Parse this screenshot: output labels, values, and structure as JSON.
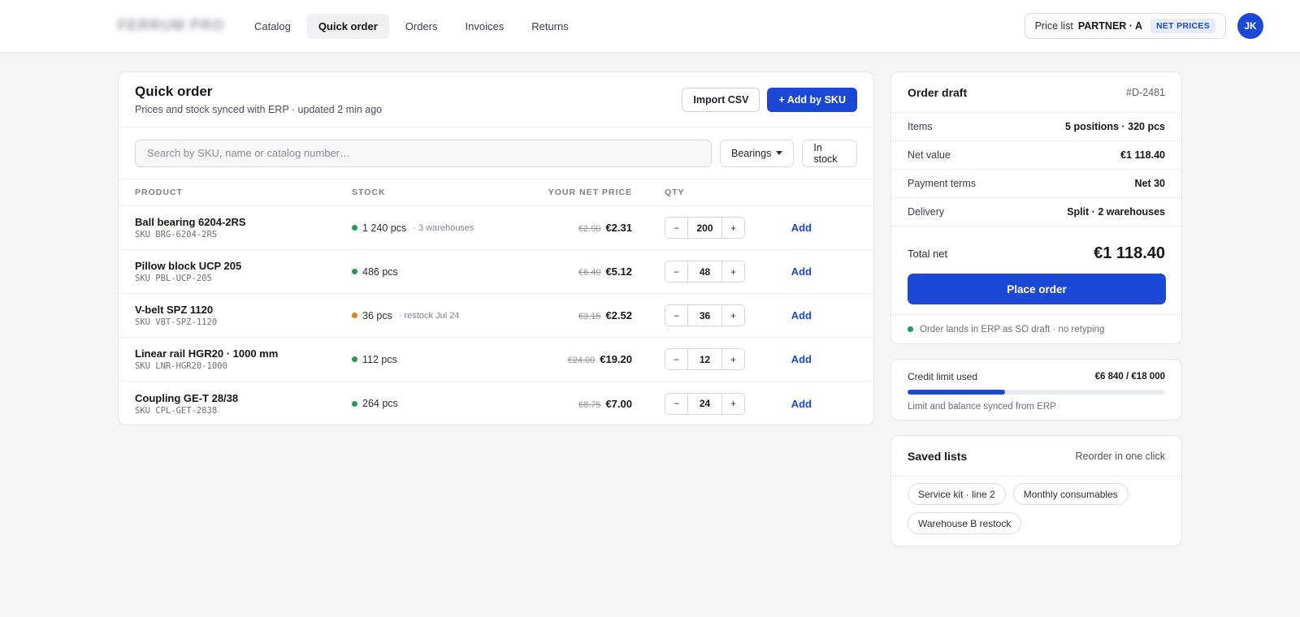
{
  "brand": {
    "name": "FERRUM PRO"
  },
  "nav": {
    "items": [
      {
        "label": "Catalog",
        "active": false
      },
      {
        "label": "Quick order",
        "active": true
      },
      {
        "label": "Orders",
        "active": false
      },
      {
        "label": "Invoices",
        "active": false
      },
      {
        "label": "Returns",
        "active": false
      }
    ]
  },
  "pricelist": {
    "label": "Price list",
    "value": "PARTNER · A",
    "badge": "NET PRICES"
  },
  "user": {
    "initials": "JK"
  },
  "quick_order": {
    "title": "Quick order",
    "subtitle": "Prices and stock synced with ERP · updated 2 min ago",
    "import_label": "Import CSV",
    "add_sku_label": "+ Add by SKU",
    "search_placeholder": "Search by SKU, name or catalog number…",
    "filter_category": "Bearings",
    "filter_stock": "In stock",
    "columns": {
      "product": "PRODUCT",
      "stock": "STOCK",
      "price": "YOUR NET PRICE",
      "qty": "QTY"
    },
    "add_label": "Add",
    "rows": [
      {
        "name": "Ball bearing 6204-2RS",
        "sku": "SKU BRG-6204-2RS",
        "stock": "1 240 pcs",
        "stock_note": "· 3 warehouses",
        "stock_status": "in",
        "old_price": "€2.90",
        "price": "€2.31",
        "qty": "200"
      },
      {
        "name": "Pillow block UCP 205",
        "sku": "SKU PBL-UCP-205",
        "stock": "486 pcs",
        "stock_note": "",
        "stock_status": "in",
        "old_price": "€6.40",
        "price": "€5.12",
        "qty": "48"
      },
      {
        "name": "V-belt SPZ 1120",
        "sku": "SKU VBT-SPZ-1120",
        "stock": "36 pcs",
        "stock_note": "· restock Jul 24",
        "stock_status": "low",
        "old_price": "€3.15",
        "price": "€2.52",
        "qty": "36"
      },
      {
        "name": "Linear rail HGR20 · 1000 mm",
        "sku": "SKU LNR-HGR20-1000",
        "stock": "112 pcs",
        "stock_note": "",
        "stock_status": "in",
        "old_price": "€24.00",
        "price": "€19.20",
        "qty": "12"
      },
      {
        "name": "Coupling GE-T 28/38",
        "sku": "SKU CPL-GET-2838",
        "stock": "264 pcs",
        "stock_note": "",
        "stock_status": "in",
        "old_price": "€8.75",
        "price": "€7.00",
        "qty": "24"
      }
    ]
  },
  "draft": {
    "title": "Order draft",
    "id": "#D-2481",
    "items_label": "Items",
    "items_value": "5 positions · 320 pcs",
    "net_label": "Net value",
    "net_value": "€1 118.40",
    "terms_label": "Payment terms",
    "terms_value": "Net 30",
    "delivery_label": "Delivery",
    "delivery_value": "Split · 2 warehouses",
    "total_label": "Total net",
    "total_value": "€1 118.40",
    "place_label": "Place order",
    "footer_note": "Order lands in ERP as SO draft · no retyping"
  },
  "credit": {
    "label": "Credit limit used",
    "value": "€6 840 / €18 000",
    "used_fraction": 0.38,
    "note": "Limit and balance synced from ERP"
  },
  "saved_lists": {
    "title": "Saved lists",
    "action": "Reorder in one click",
    "items": [
      "Service kit · line 2",
      "Monthly consumables",
      "Warehouse B restock"
    ]
  },
  "colors": {
    "accent": "#1b48d4",
    "in_stock": "#1f9d55",
    "low_stock": "#d9861c"
  },
  "icons": {
    "status": "status-dot-icon",
    "dropdown": "chevron-down-icon"
  }
}
